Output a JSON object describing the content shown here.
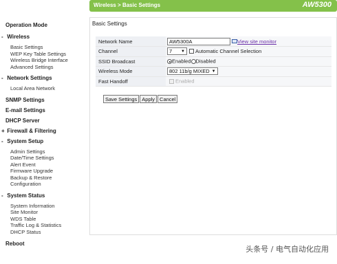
{
  "header": {
    "breadcrumb": "Wireless > Basic Settings",
    "model": "AW5300"
  },
  "sidebar": {
    "operation_mode": "Operation Mode",
    "wireless": {
      "marker": "-",
      "label": "Wireless",
      "items": [
        "Basic Settings",
        "WEP Key Table Settings",
        "Wireless Bridge Interface",
        "Advanced Settings"
      ]
    },
    "network": {
      "marker": "-",
      "label": "Network Settings",
      "items": [
        "Local Area Network"
      ]
    },
    "snmp": "SNMP Settings",
    "email": "E-mail Settings",
    "dhcp": "DHCP Server",
    "firewall": {
      "marker": "+",
      "label": "Firewall & Filtering"
    },
    "system_setup": {
      "marker": "-",
      "label": "System Setup",
      "items": [
        "Admin Settings",
        "Date/Time Settings",
        "Alert Event",
        "Firmware Upgrade",
        "Backup & Restore",
        "Configuration"
      ]
    },
    "system_status": {
      "marker": "-",
      "label": "System Status",
      "items": [
        "System Information",
        "Site Monitor",
        "WDS Table",
        "Traffic Log & Statistics",
        "DHCP Status"
      ]
    },
    "reboot": "Reboot"
  },
  "panel": {
    "title": "Basic Settings"
  },
  "form": {
    "network_name": {
      "label": "Network Name",
      "value": "AW5300A",
      "link": "View site monitor"
    },
    "channel": {
      "label": "Channel",
      "value": "7",
      "auto_label": "Automatic Channel Selection"
    },
    "ssid_broadcast": {
      "label": "SSID Broadcast",
      "enabled": "Enabled",
      "disabled": "Disabled",
      "selected": "Enabled"
    },
    "wireless_mode": {
      "label": "Wireless Mode",
      "value": "802 11b/g MIXED"
    },
    "fast_handoff": {
      "label": "Fast Handoff",
      "option": "Enabled"
    }
  },
  "buttons": {
    "save": "Save Settings",
    "apply": "Apply",
    "cancel": "Cancel"
  },
  "watermark": "头条号 / 电气自动化应用",
  "colors": {
    "header_green": "#84c14a",
    "link_purple": "#6a2fa8"
  }
}
